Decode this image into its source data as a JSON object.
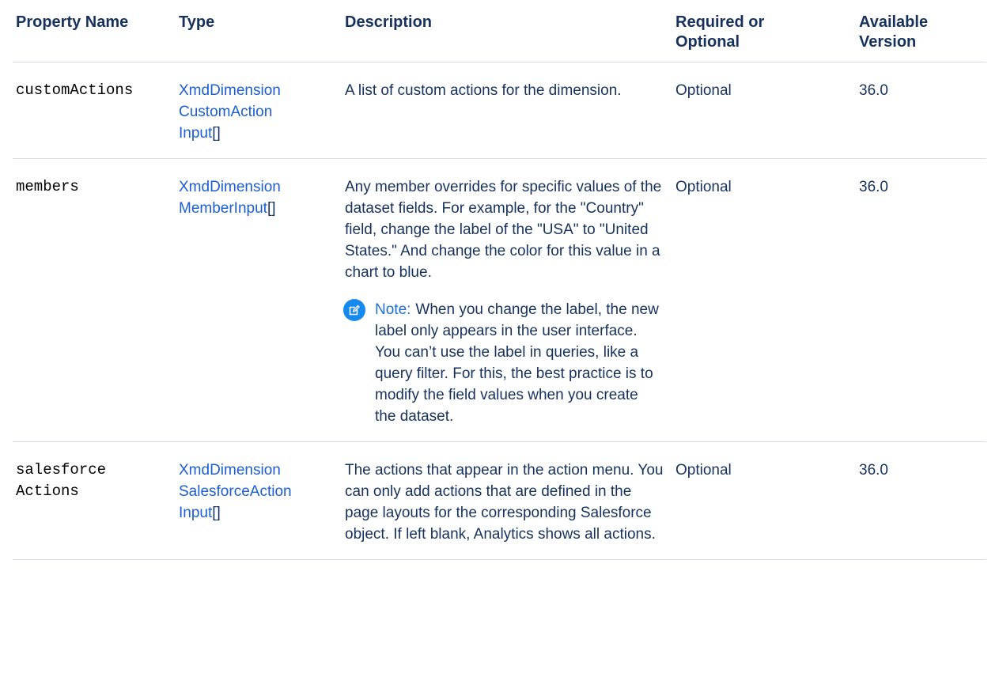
{
  "table": {
    "headers": {
      "property_name": "Property Name",
      "type": "Type",
      "description": "Description",
      "required": "Required or Optional",
      "version": "Available Version"
    },
    "rows": [
      {
        "name_lines": [
          "customActions"
        ],
        "type_link_lines": [
          "XmdDimension",
          "CustomAction",
          "Input"
        ],
        "type_suffix": "[]",
        "description": "A list of custom actions for the dimension.",
        "required": "Optional",
        "version": "36.0"
      },
      {
        "name_lines": [
          "members"
        ],
        "type_link_lines": [
          "XmdDimension",
          "MemberInput"
        ],
        "type_suffix": "[]",
        "description": "Any member overrides for specific values of the dataset fields. For example, for the \"Country\" field, change the label of the \"USA\" to \"United States.\" And change the color for this value in a chart to blue.",
        "note_label": "Note:",
        "note_text": "When you change the label, the new label only appears in the user interface. You can’t use the label in queries, like a query filter. For this, the best practice is to modify the field values when you create the dataset.",
        "required": "Optional",
        "version": "36.0"
      },
      {
        "name_lines": [
          "salesforce",
          "Actions"
        ],
        "type_link_lines": [
          "XmdDimension",
          "SalesforceAction",
          "Input"
        ],
        "type_suffix": "[]",
        "description": "The actions that appear in the action menu. You can only add actions that are defined in the page layouts for the corresponding Salesforce object. If left blank, Analytics shows all actions.",
        "required": "Optional",
        "version": "36.0"
      }
    ]
  },
  "icons": {
    "note": "note-edit-icon"
  },
  "colors": {
    "text": "#16325c",
    "link": "#1b5ed6",
    "note_icon_bg": "#1589ee",
    "divider": "#d8dde6"
  }
}
